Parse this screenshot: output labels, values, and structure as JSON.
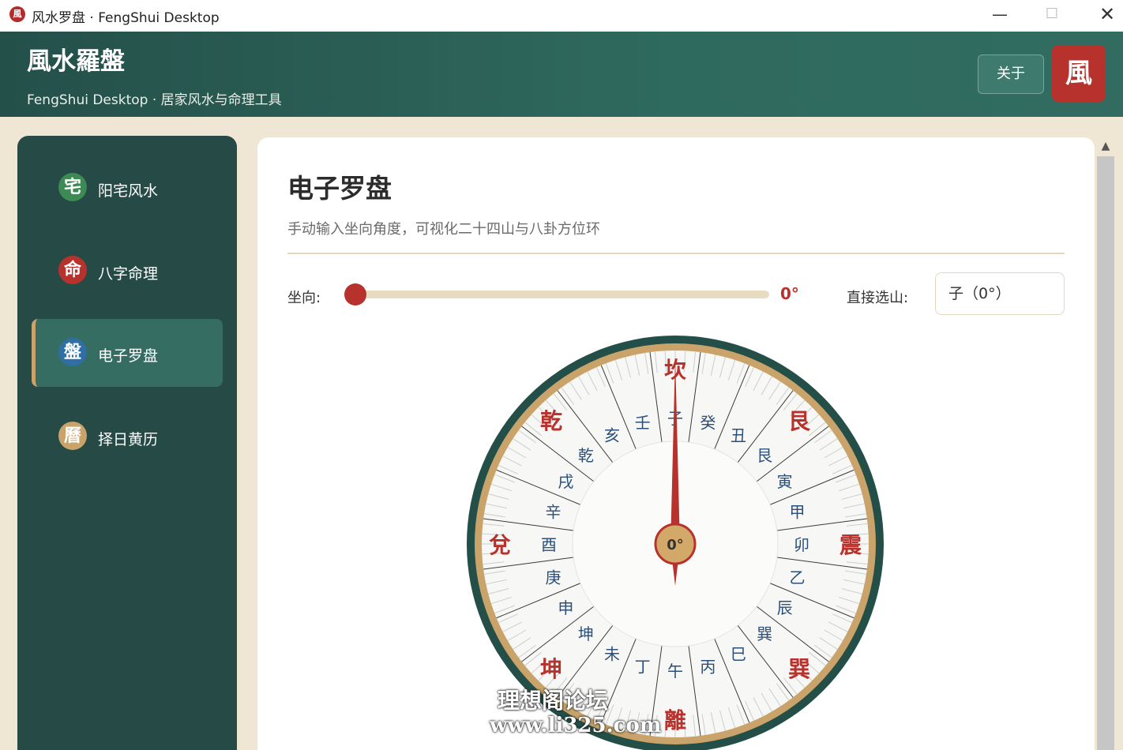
{
  "window": {
    "title": "风水罗盘 · FengShui Desktop",
    "icon_char": "風",
    "minimize": "—",
    "maximize": "☐",
    "close": "✕"
  },
  "header": {
    "brand": "風水羅盤",
    "tagline": "FengShui Desktop · 居家风水与命理工具",
    "about_label": "关于",
    "logo_char": "風"
  },
  "sidebar": {
    "items": [
      {
        "icon": "宅",
        "label": "阳宅风水",
        "color": "#3e8a55",
        "active": false
      },
      {
        "icon": "命",
        "label": "八字命理",
        "color": "#b8322d",
        "active": false
      },
      {
        "icon": "盤",
        "label": "电子罗盘",
        "color": "#2f6fa3",
        "active": true
      },
      {
        "icon": "曆",
        "label": "择日黄历",
        "color": "#c9a36a",
        "active": false
      }
    ]
  },
  "main": {
    "title": "电子罗盘",
    "subtitle": "手动输入坐向角度，可视化二十四山与八卦方位环",
    "slider_label": "坐向:",
    "degree_value": 0,
    "degree_text": "0°",
    "select_label": "直接选山:",
    "select_value": "子（0°）"
  },
  "compass": {
    "center_text": "0°",
    "heading_deg": 0,
    "trigrams": [
      "坎",
      "艮",
      "震",
      "巽",
      "離",
      "坤",
      "兌",
      "乾"
    ],
    "mountains": [
      "子",
      "癸",
      "丑",
      "艮",
      "寅",
      "甲",
      "卯",
      "乙",
      "辰",
      "巽",
      "巳",
      "丙",
      "午",
      "丁",
      "未",
      "坤",
      "申",
      "庚",
      "酉",
      "辛",
      "戌",
      "乾",
      "亥",
      "壬"
    ],
    "colors": {
      "rim": "#244e48",
      "band": "#c9a36a",
      "trigram": "#b8322d",
      "mountain": "#2c4f7a",
      "needle": "#b8322d"
    }
  },
  "watermark": {
    "line1": "理想阁论坛",
    "line2": "www.li325.com"
  }
}
